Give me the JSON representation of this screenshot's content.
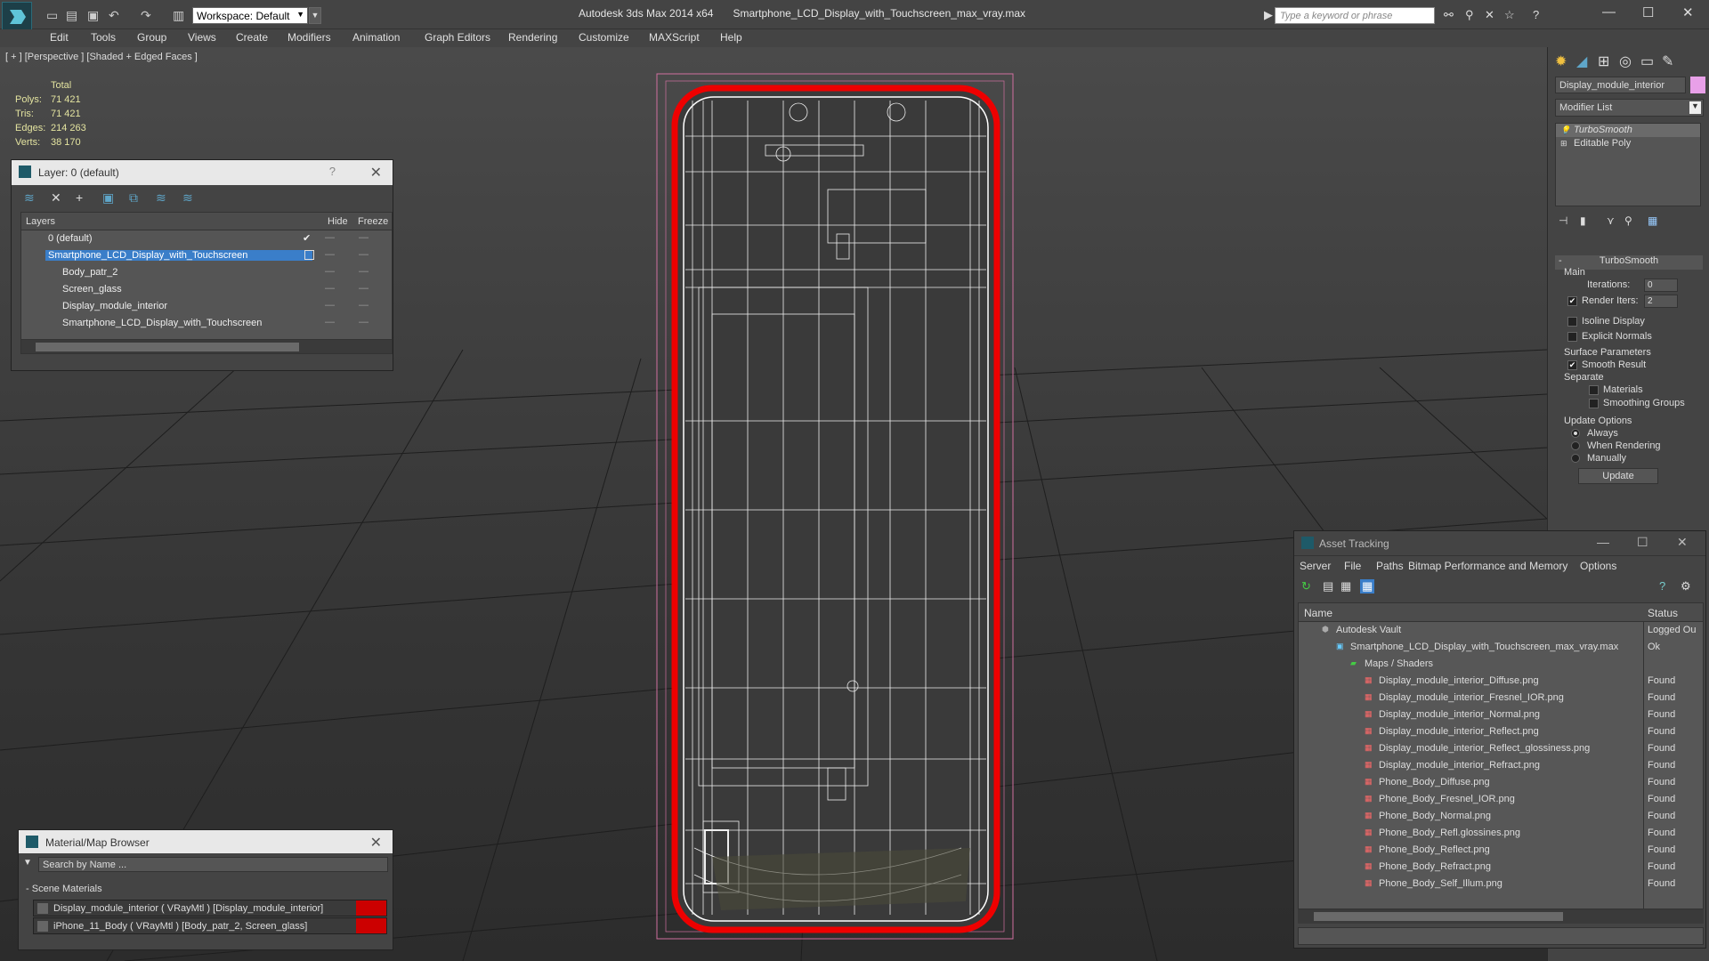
{
  "app": {
    "title": "Autodesk 3ds Max  2014 x64",
    "file": "Smartphone_LCD_Display_with_Touchscreen_max_vray.max",
    "workspace": "Workspace: Default",
    "search_placeholder": "Type a keyword or phrase"
  },
  "menu": [
    "Edit",
    "Tools",
    "Group",
    "Views",
    "Create",
    "Modifiers",
    "Animation",
    "Graph Editors",
    "Rendering",
    "Customize",
    "MAXScript",
    "Help"
  ],
  "viewport": {
    "label": "[ + ] [Perspective ] [Shaded + Edged Faces ]",
    "stats": {
      "header": "Total",
      "rows": [
        {
          "k": "Polys:",
          "v": "71 421"
        },
        {
          "k": "Tris:",
          "v": "71 421"
        },
        {
          "k": "Edges:",
          "v": "214 263"
        },
        {
          "k": "Verts:",
          "v": "38 170"
        }
      ]
    }
  },
  "layer_panel": {
    "title": "Layer: 0 (default)",
    "help": "?",
    "col_layers": "Layers",
    "col_hide": "Hide",
    "col_freeze": "Freeze",
    "rows": [
      {
        "name": "0 (default)",
        "level": 0
      },
      {
        "name": "Smartphone_LCD_Display_with_Touchscreen",
        "level": 0,
        "selected": true
      },
      {
        "name": "Body_patr_2",
        "level": 1
      },
      {
        "name": "Screen_glass",
        "level": 1
      },
      {
        "name": "Display_module_interior",
        "level": 1
      },
      {
        "name": "Smartphone_LCD_Display_with_Touchscreen",
        "level": 1
      }
    ]
  },
  "command_panel": {
    "object_name": "Display_module_interior",
    "object_color": "#e8a0e8",
    "modifier_list": "Modifier List",
    "stack": [
      "TurboSmooth",
      "Editable Poly"
    ],
    "rollout": "TurboSmooth",
    "main": "Main",
    "iterations_label": "Iterations:",
    "iterations": "0",
    "render_iters_label": "Render Iters:",
    "render_iters": "2",
    "isoline": "Isoline Display",
    "explicit_normals": "Explicit Normals",
    "surface_params": "Surface Parameters",
    "smooth_result": "Smooth Result",
    "separate": "Separate",
    "materials": "Materials",
    "smoothing_groups": "Smoothing Groups",
    "update_options": "Update Options",
    "always": "Always",
    "when_rendering": "When Rendering",
    "manually": "Manually",
    "update": "Update"
  },
  "asset_tracking": {
    "title": "Asset Tracking",
    "menu": [
      "Server",
      "File",
      "Paths",
      "Bitmap Performance and Memory",
      "Options"
    ],
    "col_name": "Name",
    "col_status": "Status",
    "rows": [
      {
        "name": "Autodesk Vault",
        "status": "Logged Ou",
        "indent": 0
      },
      {
        "name": "Smartphone_LCD_Display_with_Touchscreen_max_vray.max",
        "status": "Ok",
        "indent": 1
      },
      {
        "name": "Maps / Shaders",
        "status": "",
        "indent": 2
      },
      {
        "name": "Display_module_interior_Diffuse.png",
        "status": "Found",
        "indent": 3
      },
      {
        "name": "Display_module_interior_Fresnel_IOR.png",
        "status": "Found",
        "indent": 3
      },
      {
        "name": "Display_module_interior_Normal.png",
        "status": "Found",
        "indent": 3
      },
      {
        "name": "Display_module_interior_Reflect.png",
        "status": "Found",
        "indent": 3
      },
      {
        "name": "Display_module_interior_Reflect_glossiness.png",
        "status": "Found",
        "indent": 3
      },
      {
        "name": "Display_module_interior_Refract.png",
        "status": "Found",
        "indent": 3
      },
      {
        "name": "Phone_Body_Diffuse.png",
        "status": "Found",
        "indent": 3
      },
      {
        "name": "Phone_Body_Fresnel_IOR.png",
        "status": "Found",
        "indent": 3
      },
      {
        "name": "Phone_Body_Normal.png",
        "status": "Found",
        "indent": 3
      },
      {
        "name": "Phone_Body_Refl.glossines.png",
        "status": "Found",
        "indent": 3
      },
      {
        "name": "Phone_Body_Reflect.png",
        "status": "Found",
        "indent": 3
      },
      {
        "name": "Phone_Body_Refract.png",
        "status": "Found",
        "indent": 3
      },
      {
        "name": "Phone_Body_Self_Illum.png",
        "status": "Found",
        "indent": 3
      }
    ]
  },
  "material_browser": {
    "title": "Material/Map Browser",
    "search_placeholder": "Search by Name ...",
    "section": "Scene Materials",
    "items": [
      "Display_module_interior ( VRayMtl ) [Display_module_interior]",
      "iPhone_11_Body ( VRayMtl ) [Body_patr_2, Screen_glass]"
    ]
  }
}
